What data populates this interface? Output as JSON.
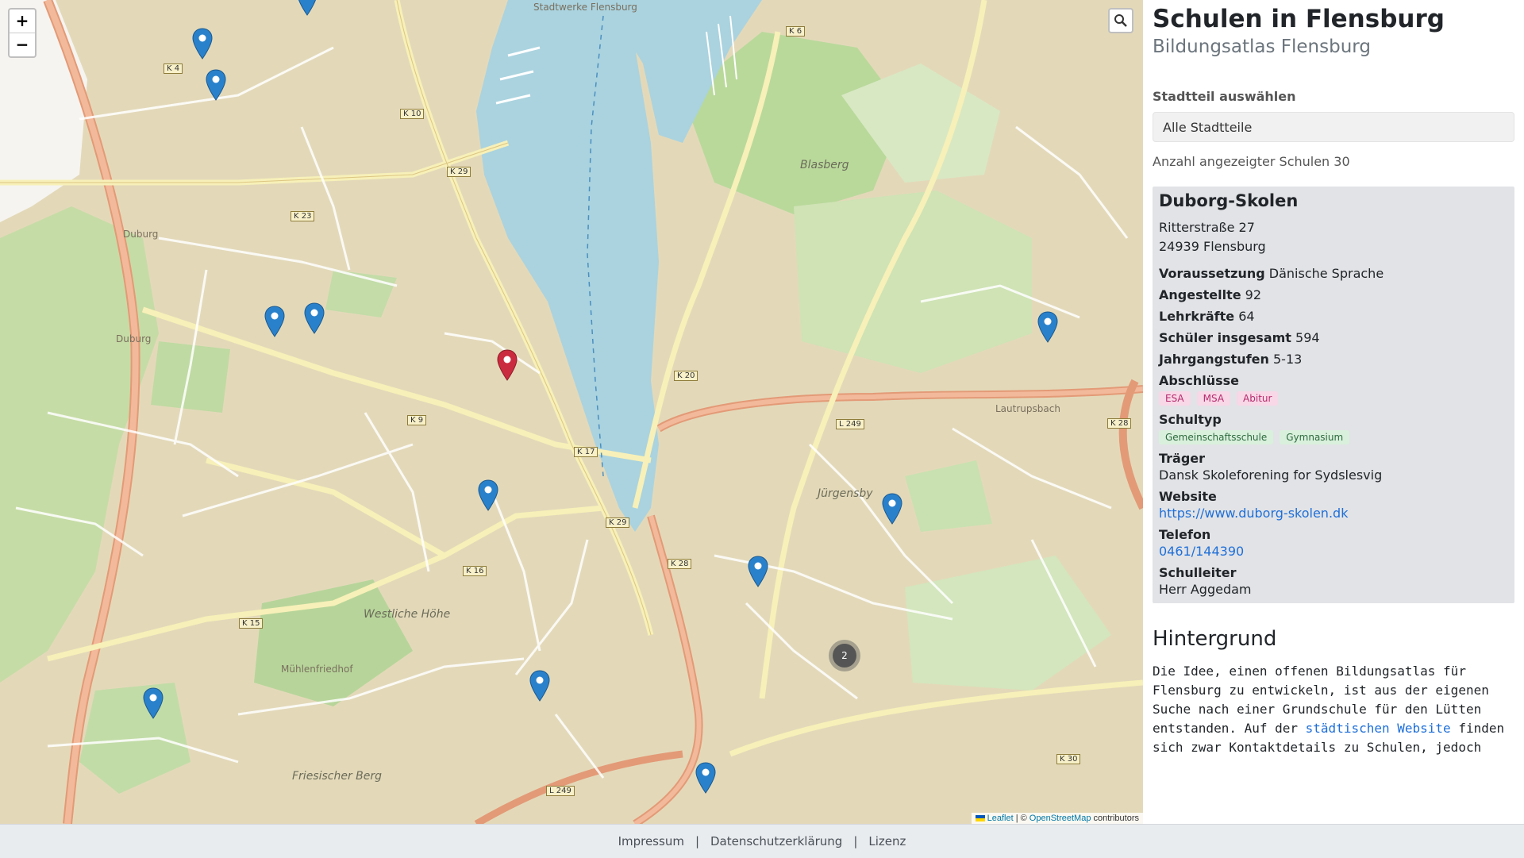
{
  "map": {
    "zoom_in": "+",
    "zoom_out": "−",
    "search_icon": "search-icon",
    "attribution": {
      "leaflet": "Leaflet",
      "sep": "| ©",
      "osm": "OpenStreetMap",
      "rest": "contributors"
    },
    "cluster_count": "2",
    "labels": {
      "blasberg": "Blasberg",
      "westliche_hoehe": "Westliche Höhe",
      "juergensby": "Jürgensby",
      "duburg": "Duburg",
      "duburg2": "Duburg",
      "muehlenfriedhof": "Mühlenfriedhof",
      "friesischer_berg": "Friesischer Berg",
      "stadtwerke": "Stadtwerke Flensburg",
      "lautrupsbach": "Lautrupsbach"
    },
    "roads": [
      "K 6",
      "K 10",
      "K 4",
      "K 29",
      "K 23",
      "K 9",
      "K 17",
      "K 20",
      "K 16",
      "K 28",
      "K 15",
      "L 249",
      "K 29",
      "K 30",
      "L 249",
      "K 28"
    ]
  },
  "sidebar": {
    "title": "Schulen in Flensburg",
    "subtitle": "Bildungsatlas Flensburg",
    "select_label": "Stadtteil auswählen",
    "select_value": "Alle Stadtteile",
    "count_text": "Anzahl angezeigter Schulen 30"
  },
  "school": {
    "name": "Duborg-Skolen",
    "street": "Ritterstraße 27",
    "city": "24939 Flensburg",
    "voraussetzung_label": "Voraussetzung",
    "voraussetzung": "Dänische Sprache",
    "angestellte_label": "Angestellte",
    "angestellte": "92",
    "lehrkraefte_label": "Lehrkräfte",
    "lehrkraefte": "64",
    "schueler_label": "Schüler insgesamt",
    "schueler": "594",
    "jahrgang_label": "Jahrgangstufen",
    "jahrgang": "5-13",
    "abschluesse_label": "Abschlüsse",
    "abschluesse": [
      "ESA",
      "MSA",
      "Abitur"
    ],
    "schultyp_label": "Schultyp",
    "schultyp": [
      "Gemeinschaftsschule",
      "Gymnasium"
    ],
    "traeger_label": "Träger",
    "traeger": "Dansk Skoleforening for Sydslesvig",
    "website_label": "Website",
    "website": "https://www.duborg-skolen.dk",
    "telefon_label": "Telefon",
    "telefon": "0461/144390",
    "leiter_label": "Schulleiter",
    "leiter": "Herr Aggedam"
  },
  "hintergrund": {
    "title": "Hintergrund",
    "text_1": "Die Idee, einen offenen Bildungsatlas für Flensburg zu entwickeln, ist aus der eigenen Suche nach einer Grundschule für den Lütten entstanden. Auf der ",
    "link": "städtischen Website",
    "text_2": " finden sich zwar Kontaktdetails zu Schulen, jedoch"
  },
  "footer": {
    "impressum": "Impressum",
    "sep": "|",
    "datenschutz": "Datenschutzerklärung",
    "lizenz": "Lizenz"
  },
  "colors": {
    "marker_blue": "#2a81cb",
    "marker_red": "#cb2b3e",
    "water": "#aad3df",
    "park": "#c8e3b0",
    "residential": "#ddd3b4",
    "major_road": "#e8a17e"
  }
}
